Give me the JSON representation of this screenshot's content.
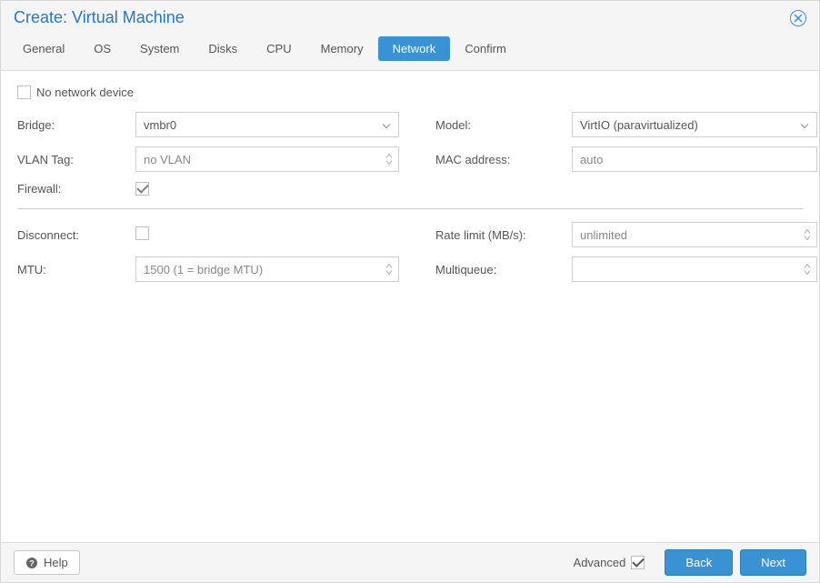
{
  "title": "Create: Virtual Machine",
  "tabs": [
    {
      "label": "General"
    },
    {
      "label": "OS"
    },
    {
      "label": "System"
    },
    {
      "label": "Disks"
    },
    {
      "label": "CPU"
    },
    {
      "label": "Memory"
    },
    {
      "label": "Network",
      "active": true
    },
    {
      "label": "Confirm"
    }
  ],
  "noNetwork": {
    "label": "No network device",
    "checked": false
  },
  "left": {
    "bridge": {
      "label": "Bridge:",
      "value": "vmbr0"
    },
    "vlan": {
      "label": "VLAN Tag:",
      "placeholder": "no VLAN"
    },
    "firewall": {
      "label": "Firewall:",
      "checked": true
    }
  },
  "right": {
    "model": {
      "label": "Model:",
      "value": "VirtIO (paravirtualized)"
    },
    "mac": {
      "label": "MAC address:",
      "placeholder": "auto"
    }
  },
  "adv": {
    "disconnect": {
      "label": "Disconnect:",
      "checked": false
    },
    "mtu": {
      "label": "MTU:",
      "placeholder": "1500 (1 = bridge MTU)"
    },
    "rate": {
      "label": "Rate limit (MB/s):",
      "placeholder": "unlimited"
    },
    "mq": {
      "label": "Multiqueue:",
      "value": ""
    }
  },
  "footer": {
    "help": "Help",
    "advanced": {
      "label": "Advanced",
      "checked": true
    },
    "back": "Back",
    "next": "Next"
  }
}
